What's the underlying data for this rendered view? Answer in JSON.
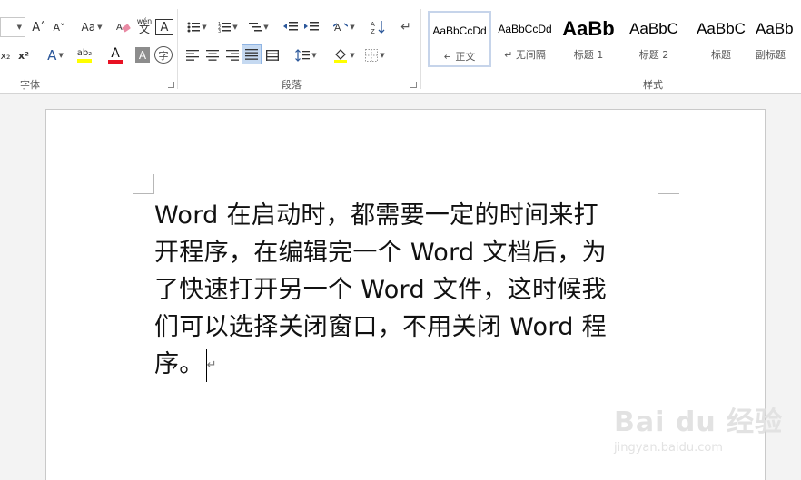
{
  "ribbon": {
    "font_group": {
      "label": "字体",
      "font_size_value": "",
      "buttons": {
        "grow_font": "A˄",
        "shrink_font": "A˅",
        "change_case": "Aa",
        "clear_format_icon": "eraser-icon",
        "phonetic": "wén",
        "phonetic_char": "文",
        "char_border": "A",
        "subscript": "x₂",
        "superscript": "x²",
        "text_effect": "A",
        "highlight": "ab₂",
        "font_color": "A",
        "char_shading": "A",
        "enclose_char": "字"
      }
    },
    "paragraph_group": {
      "label": "段落"
    },
    "styles_group": {
      "label": "样式",
      "items": [
        {
          "preview": "AaBbCcDd",
          "name": "↵ 正文",
          "selected": true
        },
        {
          "preview": "AaBbCcDd",
          "name": "↵ 无间隔",
          "selected": false
        },
        {
          "preview": "AaBb",
          "name": "标题 1",
          "selected": false
        },
        {
          "preview": "AaBbC",
          "name": "标题 2",
          "selected": false
        },
        {
          "preview": "AaBbC",
          "name": "标题",
          "selected": false
        },
        {
          "preview": "AaBb",
          "name": "副标题",
          "selected": false
        }
      ]
    }
  },
  "document": {
    "lines": [
      "Word 在启动时，都需要一定的时间来打",
      "开程序，在编辑完一个 Word 文档后，为",
      "了快速打开另一个 Word 文件，这时候我",
      "们可以选择关闭窗口，不用关闭 Word 程",
      "序。"
    ],
    "paragraph_mark": "↵"
  },
  "watermark": {
    "brand": "Bai du 经验",
    "url": "jingyan.baidu.com"
  },
  "colors": {
    "accent": "#2b579a",
    "font_color_bar": "#e81123",
    "highlight_bar": "#ffff00",
    "selected_style_border": "#c6d4ea"
  }
}
